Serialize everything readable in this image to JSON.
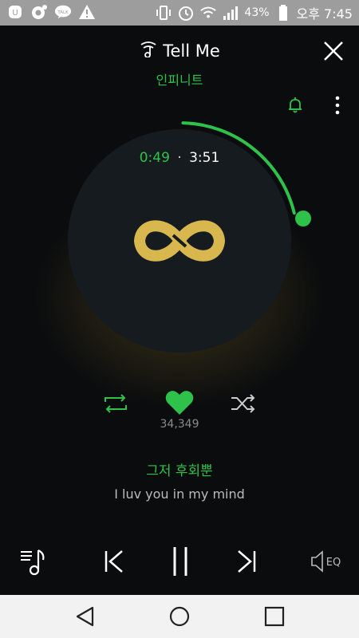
{
  "status_bar": {
    "left_icons": [
      "lg-app-icon",
      "kakao-icon",
      "talk-icon",
      "warning-icon"
    ],
    "battery_percent": "43%",
    "time": "오후 7:45"
  },
  "player": {
    "song_title": "Tell Me",
    "artist": "인피니트",
    "elapsed": "0:49",
    "separator": "·",
    "duration": "3:51",
    "progress_fraction": 0.212,
    "like_count": "34,349",
    "lyric_current": "그저 후회뿐",
    "lyric_next": "I luv you in my mind",
    "eq_label": "EQ"
  },
  "colors": {
    "accent": "#2ec24a",
    "logo_gold": "#d8b84e",
    "disc": "#151b1f",
    "status_bar": "#9d9d9d"
  }
}
